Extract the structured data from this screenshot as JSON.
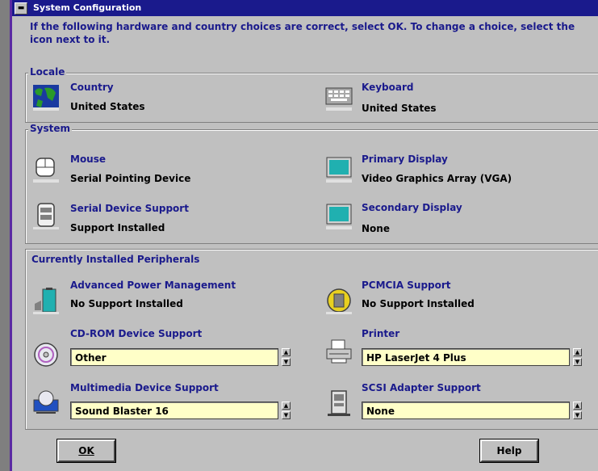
{
  "window": {
    "title": "System Configuration",
    "sysmenu": "▬"
  },
  "intro": "If the following hardware and country choices are correct, select OK. To change a choice, select the icon next to it.",
  "locale": {
    "label": "Locale",
    "country": {
      "label": "Country",
      "value": "United States"
    },
    "keyboard": {
      "label": "Keyboard",
      "value": "United States"
    }
  },
  "system": {
    "label": "System",
    "mouse": {
      "label": "Mouse",
      "value": "Serial Pointing Device"
    },
    "primary_display": {
      "label": "Primary Display",
      "value": "Video Graphics Array (VGA)"
    },
    "serial": {
      "label": "Serial Device Support",
      "value": "Support Installed"
    },
    "secondary_display": {
      "label": "Secondary Display",
      "value": "None"
    }
  },
  "peripherals": {
    "label": "Currently Installed Peripherals",
    "apm": {
      "label": "Advanced Power Management",
      "value": "No Support Installed"
    },
    "pcmcia": {
      "label": "PCMCIA Support",
      "value": "No Support Installed"
    },
    "cdrom": {
      "label": "CD-ROM Device Support",
      "selected": "Other"
    },
    "printer": {
      "label": "Printer",
      "selected": "HP LaserJet 4 Plus"
    },
    "multimedia": {
      "label": "Multimedia Device Support",
      "selected": "Sound Blaster 16"
    },
    "scsi": {
      "label": "SCSI Adapter Support",
      "selected": "None"
    }
  },
  "buttons": {
    "ok": "OK",
    "help": "Help"
  },
  "colors": {
    "title_bar": "#1a1a8c",
    "dropdown_bg": "#ffffc8",
    "label_text": "#1a1a8c"
  }
}
